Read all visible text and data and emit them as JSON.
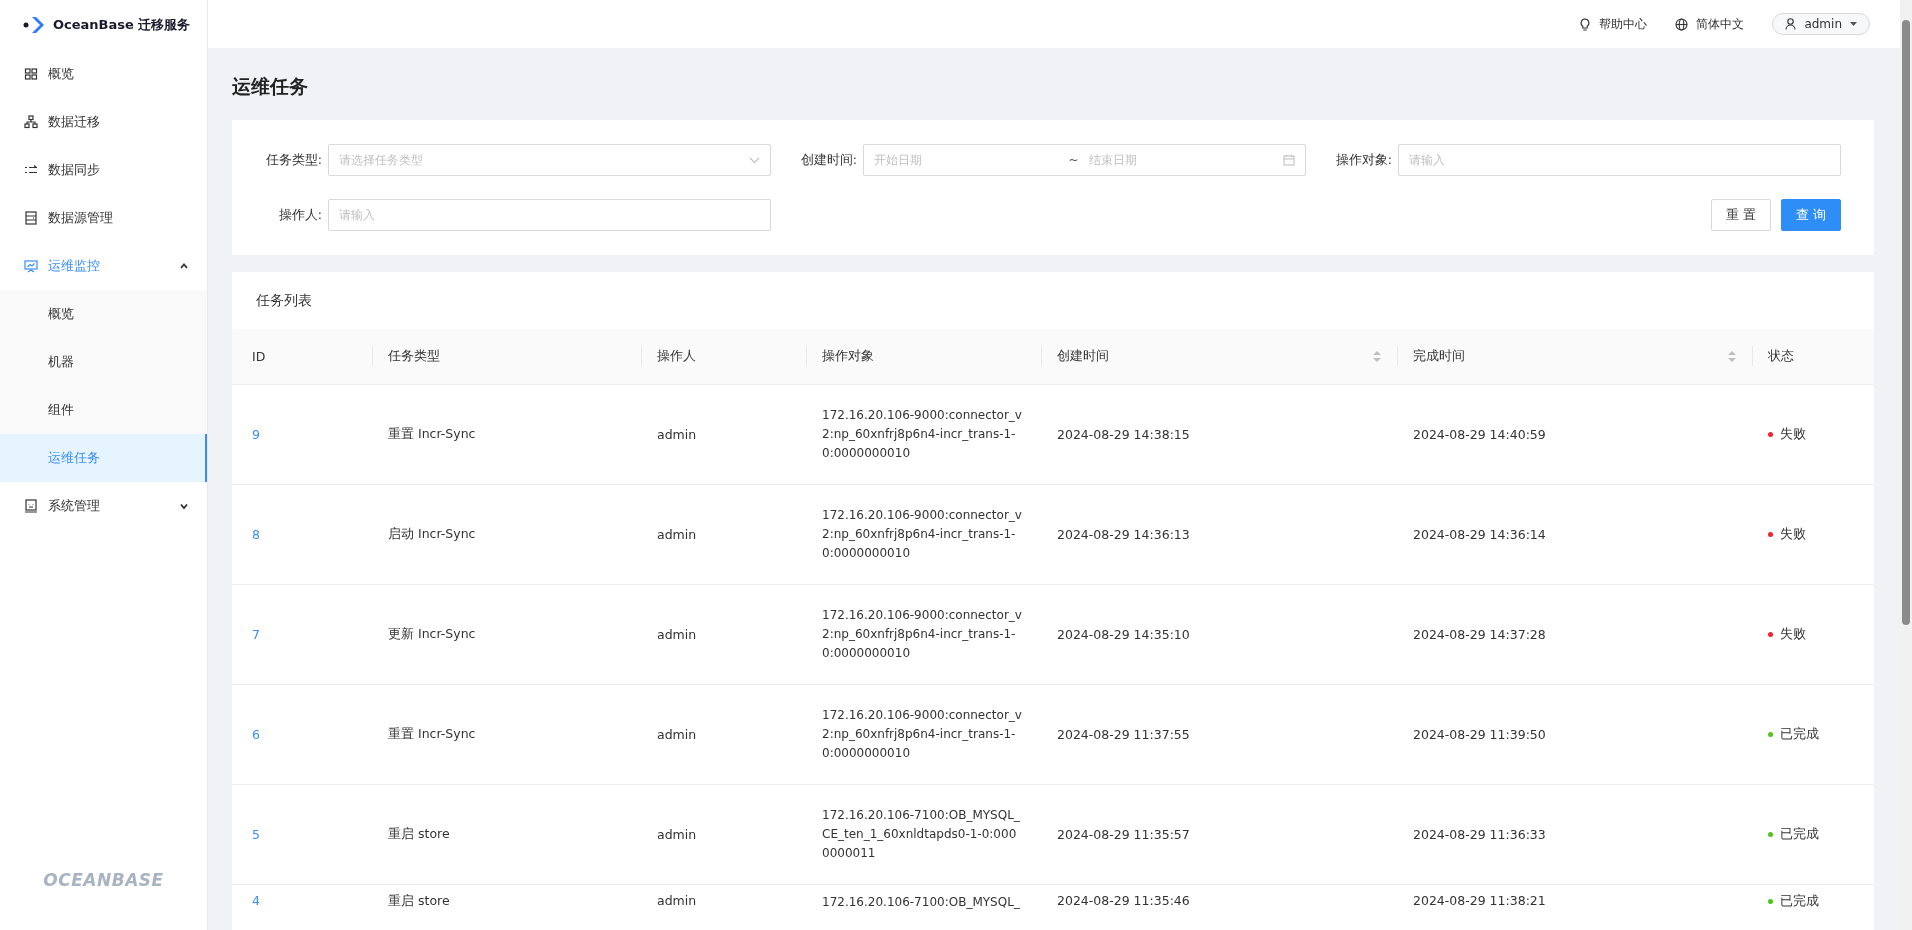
{
  "brand": {
    "name": "OceanBase 迁移服务",
    "footer_logo": "OCEANBASE"
  },
  "sidebar": {
    "items": [
      {
        "label": "概览",
        "selected": false
      },
      {
        "label": "数据迁移",
        "selected": false
      },
      {
        "label": "数据同步",
        "selected": false
      },
      {
        "label": "数据源管理",
        "selected": false
      },
      {
        "label": "运维监控",
        "selected": true,
        "expanded": true,
        "children": [
          {
            "label": "概览",
            "selected": false
          },
          {
            "label": "机器",
            "selected": false
          },
          {
            "label": "组件",
            "selected": false
          },
          {
            "label": "运维任务",
            "selected": true
          }
        ]
      },
      {
        "label": "系统管理",
        "selected": false,
        "expanded": false
      }
    ]
  },
  "header": {
    "help": "帮助中心",
    "language": "简体中文",
    "user": "admin"
  },
  "page_title": "运维任务",
  "filters": {
    "task_type": {
      "label": "任务类型:",
      "placeholder": "请选择任务类型"
    },
    "created_time": {
      "label": "创建时间:",
      "start_placeholder": "开始日期",
      "separator": "~",
      "end_placeholder": "结束日期"
    },
    "target": {
      "label": "操作对象:",
      "placeholder": "请输入"
    },
    "operator": {
      "label": "操作人:",
      "placeholder": "请输入"
    },
    "buttons": [
      "重 置",
      "查 询"
    ]
  },
  "table": {
    "title": "任务列表",
    "columns": [
      {
        "label": "ID",
        "sortable": false
      },
      {
        "label": "任务类型",
        "sortable": false
      },
      {
        "label": "操作人",
        "sortable": false
      },
      {
        "label": "操作对象",
        "sortable": false
      },
      {
        "label": "创建时间",
        "sortable": true
      },
      {
        "label": "完成时间",
        "sortable": true
      },
      {
        "label": "状态",
        "sortable": false
      }
    ],
    "rows": [
      {
        "id": "9",
        "type": "重置 Incr-Sync",
        "operator": "admin",
        "target": [
          "172.16.20.106-9000:connector_v",
          "2:np_60xnfrj8p6n4-incr_trans-1-",
          "0:0000000010"
        ],
        "created": "2024-08-29 14:38:15",
        "finished": "2024-08-29 14:40:59",
        "status": "失败",
        "color": "#f5222d"
      },
      {
        "id": "8",
        "type": "启动 Incr-Sync",
        "operator": "admin",
        "target": [
          "172.16.20.106-9000:connector_v",
          "2:np_60xnfrj8p6n4-incr_trans-1-",
          "0:0000000010"
        ],
        "created": "2024-08-29 14:36:13",
        "finished": "2024-08-29 14:36:14",
        "status": "失败",
        "color": "#f5222d"
      },
      {
        "id": "7",
        "type": "更新 Incr-Sync",
        "operator": "admin",
        "target": [
          "172.16.20.106-9000:connector_v",
          "2:np_60xnfrj8p6n4-incr_trans-1-",
          "0:0000000010"
        ],
        "created": "2024-08-29 14:35:10",
        "finished": "2024-08-29 14:37:28",
        "status": "失败",
        "color": "#f5222d"
      },
      {
        "id": "6",
        "type": "重置 Incr-Sync",
        "operator": "admin",
        "target": [
          "172.16.20.106-9000:connector_v",
          "2:np_60xnfrj8p6n4-incr_trans-1-",
          "0:0000000010"
        ],
        "created": "2024-08-29 11:37:55",
        "finished": "2024-08-29 11:39:50",
        "status": "已完成",
        "color": "#52c41a"
      },
      {
        "id": "5",
        "type": "重启 store",
        "operator": "admin",
        "target": [
          "172.16.20.106-7100:OB_MYSQL_",
          "CE_ten_1_60xnldtapds0-1-0:000",
          "0000011"
        ],
        "created": "2024-08-29 11:35:57",
        "finished": "2024-08-29 11:36:33",
        "status": "已完成",
        "color": "#52c41a"
      },
      {
        "id": "4",
        "type": "重启 store",
        "operator": "admin",
        "target": [
          "172.16.20.106-7100:OB_MYSQL_"
        ],
        "created": "2024-08-29 11:35:46",
        "finished": "2024-08-29 11:38:21",
        "status": "已完成",
        "color": "#52c41a"
      }
    ]
  }
}
